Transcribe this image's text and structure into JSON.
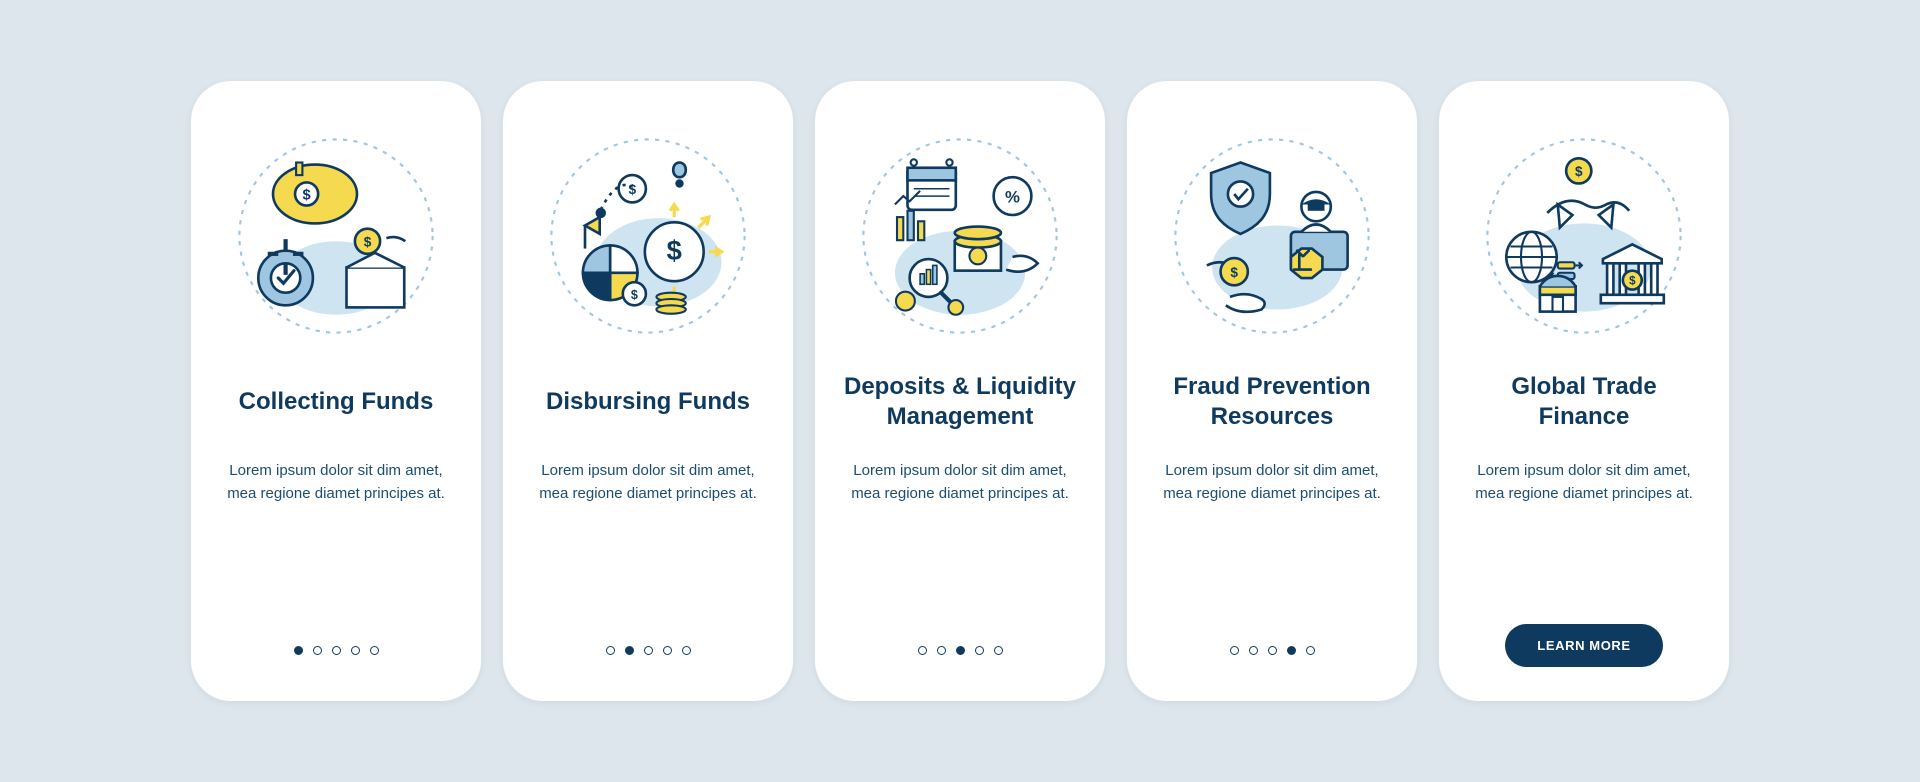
{
  "colors": {
    "background": "#dce6ec",
    "card": "#ffffff",
    "primary": "#0f3a5f",
    "accentYellow": "#f5d94f",
    "accentBlue": "#9fc6e0",
    "stroke": "#0f3a5f"
  },
  "cards": [
    {
      "title": "Collecting Funds",
      "desc": "Lorem ipsum dolor sit dim amet, mea regione diamet principes at.",
      "activeDot": 0,
      "cta": null
    },
    {
      "title": "Disbursing Funds",
      "desc": "Lorem ipsum dolor sit dim amet, mea regione diamet principes at.",
      "activeDot": 1,
      "cta": null
    },
    {
      "title": "Deposits & Liquidity\nManagement",
      "desc": "Lorem ipsum dolor sit dim amet, mea regione diamet principes at.",
      "activeDot": 2,
      "cta": null
    },
    {
      "title": "Fraud Prevention\nResources",
      "desc": "Lorem ipsum dolor sit dim amet, mea regione diamet principes at.",
      "activeDot": 3,
      "cta": null
    },
    {
      "title": "Global Trade\nFinance",
      "desc": "Lorem ipsum dolor sit dim amet, mea regione diamet principes at.",
      "activeDot": 4,
      "cta": "LEARN MORE"
    }
  ],
  "dotCount": 5
}
